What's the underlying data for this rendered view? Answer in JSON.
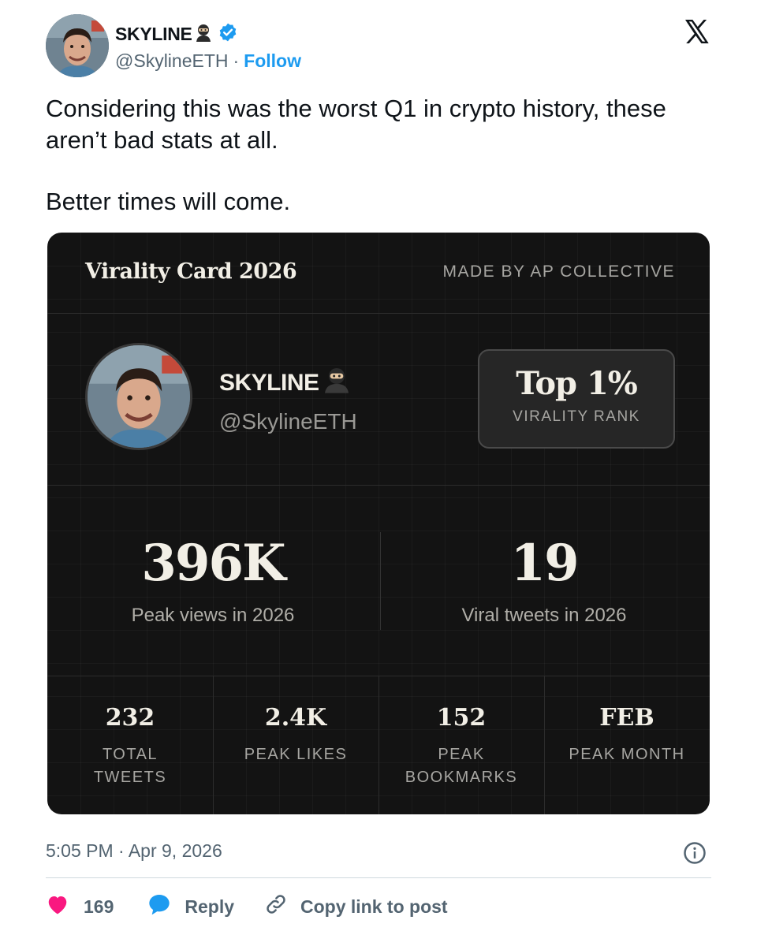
{
  "author": {
    "name": "SKYLINE",
    "handle": "@SkylineETH",
    "separator": "·",
    "follow_label": "Follow",
    "verified": true
  },
  "platform_icon": "x-logo-icon",
  "tweet": {
    "line1": "Considering this was the worst Q1 in crypto history, these aren’t bad stats at all.",
    "line2": "Better times will come."
  },
  "card": {
    "title": "Virality Card 2026",
    "credit": "MADE BY AP COLLECTIVE",
    "name": "SKYLINE",
    "handle": "@SkylineETH",
    "rank_value": "Top 1%",
    "rank_label": "VIRALITY RANK",
    "big_stats": [
      {
        "value": "396K",
        "label": "Peak views in 2026"
      },
      {
        "value": "19",
        "label": "Viral tweets in 2026"
      }
    ],
    "small_stats": [
      {
        "value": "232",
        "label": "TOTAL\nTWEETS"
      },
      {
        "value": "2.4K",
        "label": "PEAK LIKES"
      },
      {
        "value": "152",
        "label": "PEAK\nBOOKMARKS"
      },
      {
        "value": "FEB",
        "label": "PEAK MONTH"
      }
    ],
    "colors": {
      "background": "#131313",
      "text": "#f2efe6",
      "muted": "#a7a6a2"
    }
  },
  "footer": {
    "timestamp": "5:05 PM · Apr 9, 2026",
    "like_count": "169",
    "reply_label": "Reply",
    "copy_label": "Copy link to post"
  },
  "colors": {
    "accent": "#1d9bf0",
    "like": "#f91880",
    "muted": "#536471"
  }
}
